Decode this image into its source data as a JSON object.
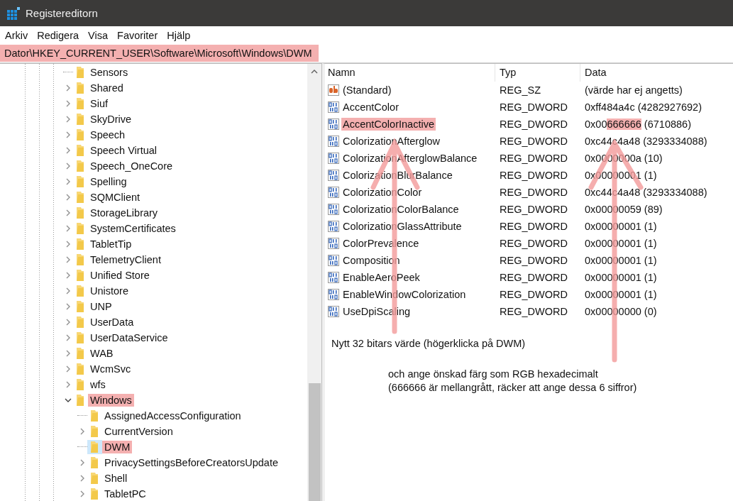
{
  "window": {
    "title": "Registereditorn"
  },
  "menu": [
    "Arkiv",
    "Redigera",
    "Visa",
    "Favoriter",
    "Hjälp"
  ],
  "address": {
    "value": "Dator\\HKEY_CURRENT_USER\\Software\\Microsoft\\Windows\\DWM",
    "highlighted": true
  },
  "tree": [
    {
      "label": "Sensors",
      "has_children": false,
      "expanded": false,
      "highlighted": false,
      "selected": false
    },
    {
      "label": "Shared",
      "has_children": true,
      "expanded": false,
      "highlighted": false,
      "selected": false
    },
    {
      "label": "Siuf",
      "has_children": true,
      "expanded": false,
      "highlighted": false,
      "selected": false
    },
    {
      "label": "SkyDrive",
      "has_children": true,
      "expanded": false,
      "highlighted": false,
      "selected": false
    },
    {
      "label": "Speech",
      "has_children": true,
      "expanded": false,
      "highlighted": false,
      "selected": false
    },
    {
      "label": "Speech Virtual",
      "has_children": true,
      "expanded": false,
      "highlighted": false,
      "selected": false
    },
    {
      "label": "Speech_OneCore",
      "has_children": true,
      "expanded": false,
      "highlighted": false,
      "selected": false
    },
    {
      "label": "Spelling",
      "has_children": true,
      "expanded": false,
      "highlighted": false,
      "selected": false
    },
    {
      "label": "SQMClient",
      "has_children": true,
      "expanded": false,
      "highlighted": false,
      "selected": false
    },
    {
      "label": "StorageLibrary",
      "has_children": true,
      "expanded": false,
      "highlighted": false,
      "selected": false
    },
    {
      "label": "SystemCertificates",
      "has_children": true,
      "expanded": false,
      "highlighted": false,
      "selected": false
    },
    {
      "label": "TabletTip",
      "has_children": true,
      "expanded": false,
      "highlighted": false,
      "selected": false
    },
    {
      "label": "TelemetryClient",
      "has_children": true,
      "expanded": false,
      "highlighted": false,
      "selected": false
    },
    {
      "label": "Unified Store",
      "has_children": true,
      "expanded": false,
      "highlighted": false,
      "selected": false
    },
    {
      "label": "Unistore",
      "has_children": true,
      "expanded": false,
      "highlighted": false,
      "selected": false
    },
    {
      "label": "UNP",
      "has_children": true,
      "expanded": false,
      "highlighted": false,
      "selected": false
    },
    {
      "label": "UserData",
      "has_children": true,
      "expanded": false,
      "highlighted": false,
      "selected": false
    },
    {
      "label": "UserDataService",
      "has_children": true,
      "expanded": false,
      "highlighted": false,
      "selected": false
    },
    {
      "label": "WAB",
      "has_children": true,
      "expanded": false,
      "highlighted": false,
      "selected": false
    },
    {
      "label": "WcmSvc",
      "has_children": true,
      "expanded": false,
      "highlighted": false,
      "selected": false
    },
    {
      "label": "wfs",
      "has_children": true,
      "expanded": false,
      "highlighted": false,
      "selected": false
    },
    {
      "label": "Windows",
      "has_children": true,
      "expanded": true,
      "highlighted": true,
      "selected": false,
      "children": [
        {
          "label": "AssignedAccessConfiguration",
          "has_children": false,
          "expanded": false,
          "highlighted": false,
          "selected": false
        },
        {
          "label": "CurrentVersion",
          "has_children": true,
          "expanded": false,
          "highlighted": false,
          "selected": false
        },
        {
          "label": "DWM",
          "has_children": false,
          "expanded": false,
          "highlighted": true,
          "selected": true
        },
        {
          "label": "PrivacySettingsBeforeCreatorsUpdate",
          "has_children": true,
          "expanded": false,
          "highlighted": false,
          "selected": false
        },
        {
          "label": "Shell",
          "has_children": true,
          "expanded": false,
          "highlighted": false,
          "selected": false
        },
        {
          "label": "TabletPC",
          "has_children": true,
          "expanded": false,
          "highlighted": false,
          "selected": false
        }
      ]
    }
  ],
  "table": {
    "columns": [
      "Namn",
      "Typ",
      "Data"
    ],
    "rows": [
      {
        "kind": "string",
        "name": "(Standard)",
        "name_highlighted": false,
        "type": "REG_SZ",
        "data": [
          {
            "text": "(värde har ej angetts)",
            "highlighted": false
          }
        ]
      },
      {
        "kind": "dword",
        "name": "AccentColor",
        "name_highlighted": false,
        "type": "REG_DWORD",
        "data": [
          {
            "text": "0xff484a4c (4282927692)",
            "highlighted": false
          }
        ]
      },
      {
        "kind": "dword",
        "name": "AccentColorInactive",
        "name_highlighted": true,
        "type": "REG_DWORD",
        "data": [
          {
            "text": "0x00",
            "highlighted": false
          },
          {
            "text": "666666",
            "highlighted": true
          },
          {
            "text": " (6710886)",
            "highlighted": false
          }
        ]
      },
      {
        "kind": "dword",
        "name": "ColorizationAfterglow",
        "name_highlighted": false,
        "type": "REG_DWORD",
        "data": [
          {
            "text": "0xc44c4a48 (3293334088)",
            "highlighted": false
          }
        ]
      },
      {
        "kind": "dword",
        "name": "ColorizationAfterglowBalance",
        "name_highlighted": false,
        "type": "REG_DWORD",
        "data": [
          {
            "text": "0x0000000a (10)",
            "highlighted": false
          }
        ]
      },
      {
        "kind": "dword",
        "name": "ColorizationBlurBalance",
        "name_highlighted": false,
        "type": "REG_DWORD",
        "data": [
          {
            "text": "0x00000001 (1)",
            "highlighted": false
          }
        ]
      },
      {
        "kind": "dword",
        "name": "ColorizationColor",
        "name_highlighted": false,
        "type": "REG_DWORD",
        "data": [
          {
            "text": "0xc44c4a48 (3293334088)",
            "highlighted": false
          }
        ]
      },
      {
        "kind": "dword",
        "name": "ColorizationColorBalance",
        "name_highlighted": false,
        "type": "REG_DWORD",
        "data": [
          {
            "text": "0x00000059 (89)",
            "highlighted": false
          }
        ]
      },
      {
        "kind": "dword",
        "name": "ColorizationGlassAttribute",
        "name_highlighted": false,
        "type": "REG_DWORD",
        "data": [
          {
            "text": "0x00000001 (1)",
            "highlighted": false
          }
        ]
      },
      {
        "kind": "dword",
        "name": "ColorPrevalence",
        "name_highlighted": false,
        "type": "REG_DWORD",
        "data": [
          {
            "text": "0x00000001 (1)",
            "highlighted": false
          }
        ]
      },
      {
        "kind": "dword",
        "name": "Composition",
        "name_highlighted": false,
        "type": "REG_DWORD",
        "data": [
          {
            "text": "0x00000001 (1)",
            "highlighted": false
          }
        ]
      },
      {
        "kind": "dword",
        "name": "EnableAeroPeek",
        "name_highlighted": false,
        "type": "REG_DWORD",
        "data": [
          {
            "text": "0x00000001 (1)",
            "highlighted": false
          }
        ]
      },
      {
        "kind": "dword",
        "name": "EnableWindowColorization",
        "name_highlighted": false,
        "type": "REG_DWORD",
        "data": [
          {
            "text": "0x00000001 (1)",
            "highlighted": false
          }
        ]
      },
      {
        "kind": "dword",
        "name": "UseDpiScaling",
        "name_highlighted": false,
        "type": "REG_DWORD",
        "data": [
          {
            "text": "0x00000000 (0)",
            "highlighted": false
          }
        ]
      }
    ]
  },
  "annotations": [
    {
      "kind": "note",
      "text": "Nytt 32 bitars värde (högerklicka på DWM)"
    },
    {
      "kind": "indented",
      "text": "och ange önskad färg som RGB hexadecimalt\n(666666 är mellangrått, räcker att ange dessa 6 siffror)"
    }
  ]
}
